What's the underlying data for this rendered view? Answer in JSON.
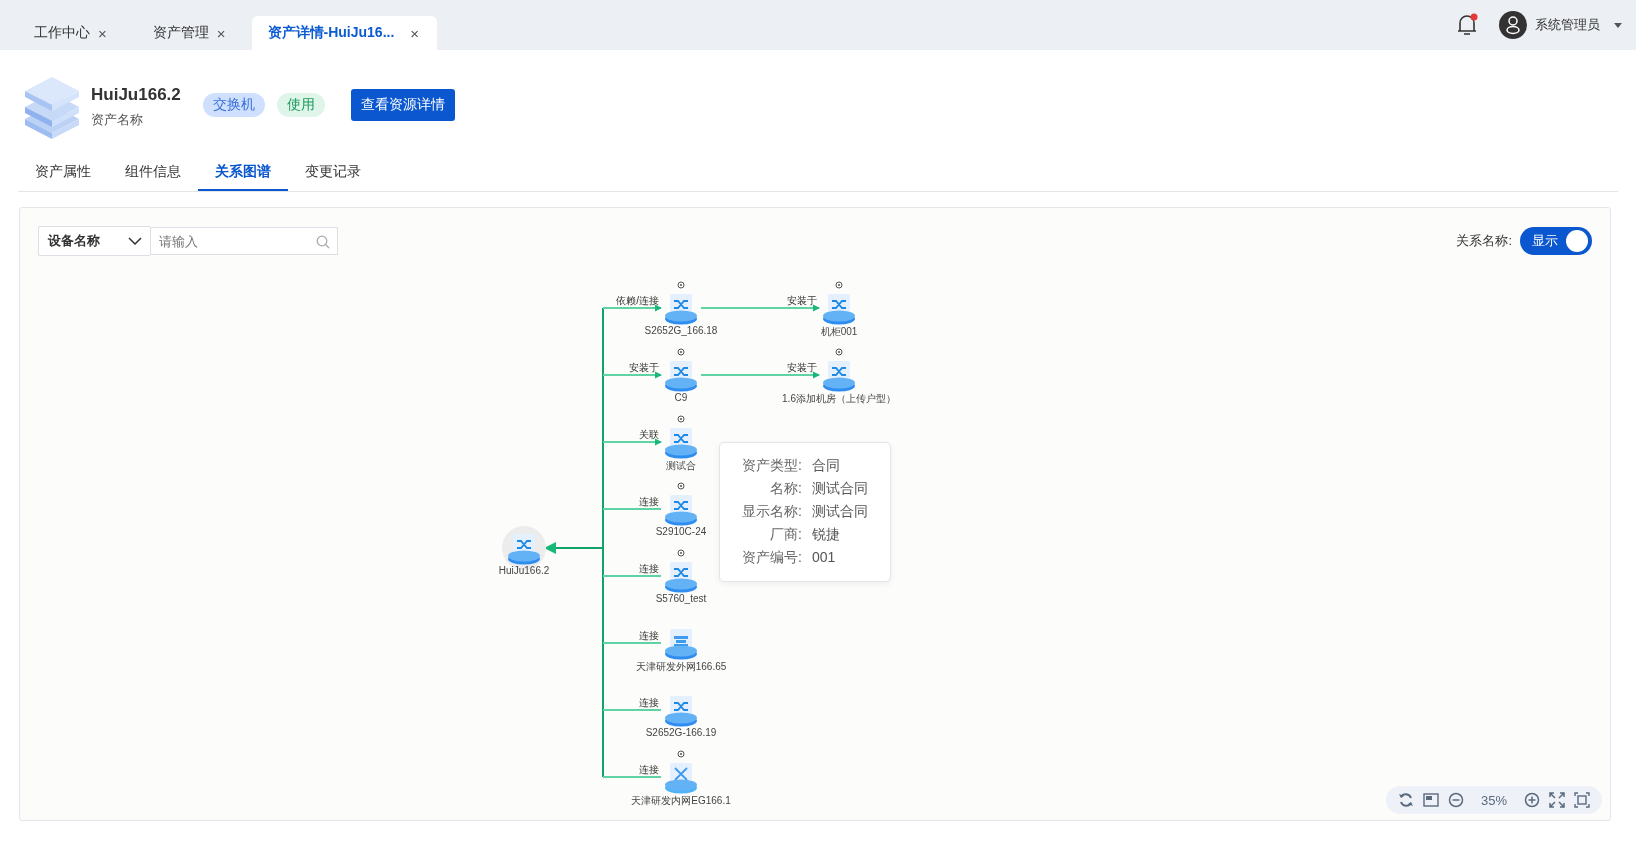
{
  "tabs": [
    {
      "label": "工作中心",
      "close": "×",
      "selected": false
    },
    {
      "label": "资产管理",
      "close": "×",
      "selected": false
    },
    {
      "label": "资产详情-HuiJu16...",
      "close": "×",
      "selected": true
    }
  ],
  "user": {
    "name": "系统管理员",
    "has_notification": true
  },
  "asset": {
    "title": "HuiJu166.2",
    "subtitle": "资产名称",
    "tags": [
      {
        "label": "交换机",
        "color": "#cfe0ff"
      },
      {
        "label": "使用",
        "color": "#dff5ea"
      }
    ],
    "detail_button": "查看资源详情"
  },
  "detail_tabs": [
    {
      "label": "资产属性",
      "selected": false
    },
    {
      "label": "组件信息",
      "selected": false
    },
    {
      "label": "关系图谱",
      "selected": true
    },
    {
      "label": "变更记录",
      "selected": false
    }
  ],
  "filter": {
    "field": "设备名称",
    "placeholder": "请输入"
  },
  "relation_toggle": {
    "label": "关系名称:",
    "text": "显示",
    "on": true
  },
  "graph": {
    "root": {
      "label": "HuiJu166.2",
      "kind": "switch"
    },
    "children": [
      {
        "label": "S2652G_166.18",
        "kind": "switch",
        "badge": true,
        "edge_label": "依赖/连接",
        "arrow": true,
        "children": [
          {
            "label": "机柜001",
            "kind": "switch",
            "badge": true,
            "edge_label": "安装于",
            "arrow": true
          }
        ]
      },
      {
        "label": "C9",
        "kind": "switch",
        "badge": true,
        "edge_label": "安装于",
        "arrow": true,
        "children": [
          {
            "label": "1.6添加机房（上传户型）",
            "kind": "switch",
            "badge": true,
            "edge_label": "安装于",
            "arrow": true
          }
        ]
      },
      {
        "label": "测试合",
        "kind": "switch",
        "badge": true,
        "edge_label": "关联",
        "arrow": true
      },
      {
        "label": "S2910C-24",
        "kind": "switch",
        "badge": true,
        "edge_label": "连接",
        "arrow": false
      },
      {
        "label": "S5760_test",
        "kind": "switch",
        "badge": true,
        "edge_label": "连接",
        "arrow": false
      },
      {
        "label": "天津研发外网166.65",
        "kind": "firewall",
        "badge": false,
        "edge_label": "连接",
        "arrow": false
      },
      {
        "label": "S2652G-166.19",
        "kind": "switch",
        "badge": false,
        "edge_label": "连接",
        "arrow": false
      },
      {
        "label": "天津研发内网EG166.1",
        "kind": "router",
        "badge": true,
        "edge_label": "连接",
        "arrow": false
      }
    ]
  },
  "tooltip": [
    {
      "label": "资产类型:",
      "value": "合同"
    },
    {
      "label": "名称:",
      "value": "测试合同"
    },
    {
      "label": "显示名称:",
      "value": "测试合同"
    },
    {
      "label": "厂商:",
      "value": "锐捷"
    },
    {
      "label": "资产编号:",
      "value": "001"
    }
  ],
  "zoom_level": "35%"
}
